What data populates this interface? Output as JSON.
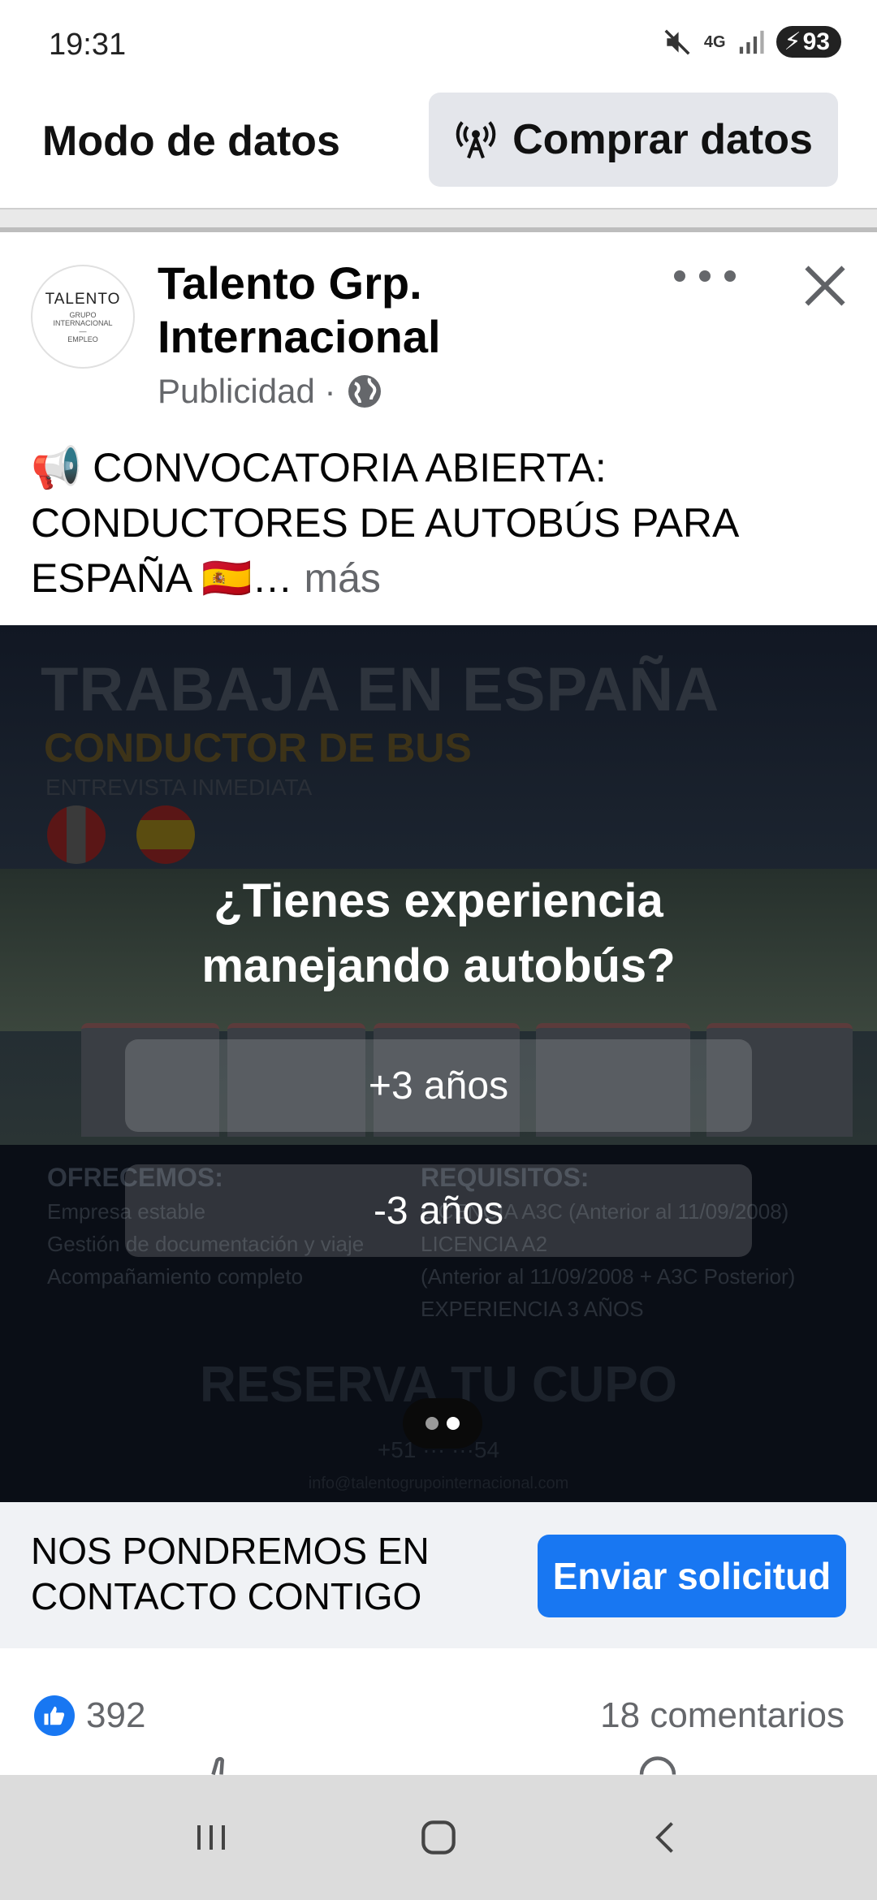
{
  "status_bar": {
    "time": "19:31",
    "network": "4G",
    "battery": "93",
    "icons": [
      "mute-icon",
      "signal-icon",
      "battery-charging-icon"
    ]
  },
  "data_bar": {
    "title": "Modo de datos",
    "buy_button": "Comprar datos"
  },
  "post": {
    "page_name": "Talento Grp. Internacional",
    "sponsored": "Publicidad ·",
    "avatar": {
      "main": "TALENTO",
      "sub_lines": [
        "GRUPO",
        "INTERNACIONAL",
        "—",
        "EMPLEO"
      ]
    },
    "caption": "📢 CONVOCATORIA ABIERTA: CONDUCTORES DE AUTOBÚS PARA ESPAÑA 🇪🇸…",
    "caption_more": " más"
  },
  "media": {
    "background": {
      "headline": "TRABAJA EN ESPAÑA",
      "subheadline": "CONDUCTOR DE BUS",
      "tagline": "ENTREVISTA INMEDIATA",
      "offer_title": "OFRECEMOS:",
      "offer_items": [
        "Empresa estable",
        "Gestión de documentación y viaje",
        "Acompañamiento completo"
      ],
      "req_title": "REQUISITOS:",
      "req_items": [
        "LICENCIA A3C (Anterior al 11/09/2008)",
        "LICENCIA A2",
        "(Anterior al 11/09/2008 + A3C Posterior)",
        "EXPERIENCIA 3 AÑOS"
      ],
      "reserve": "RESERVA TU CUPO",
      "phone": "+51 ··· ···54",
      "email": "info@talentogrupointernacional.com"
    },
    "poll": {
      "question": "¿Tienes experiencia manejando autobús?",
      "options": [
        "+3 años",
        "-3 años"
      ]
    },
    "pager": {
      "count": 2,
      "active": 1
    }
  },
  "cta": {
    "text": "NOS PONDREMOS EN CONTACTO CONTIGO",
    "button": "Enviar solicitud"
  },
  "reactions": {
    "likes": "392",
    "comments": "18 comentarios"
  },
  "colors": {
    "brand_blue": "#1877f2",
    "secondary_text": "#65676b",
    "media_bg": "#0b0f17"
  }
}
